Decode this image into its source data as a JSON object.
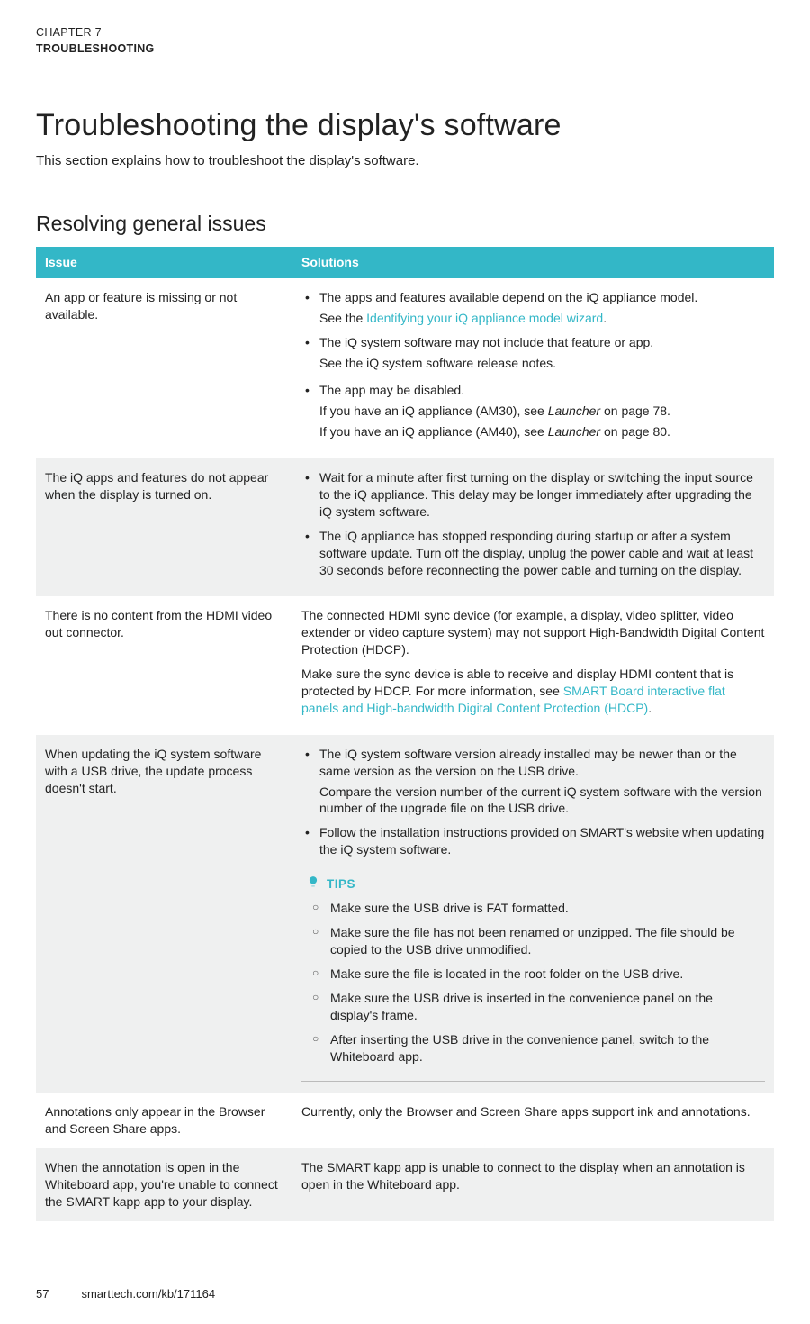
{
  "chapter": {
    "line": "CHAPTER 7",
    "title": "TROUBLESHOOTING"
  },
  "page_title": "Troubleshooting the display's software",
  "intro": "This section explains how to troubleshoot the display's software.",
  "section_title": "Resolving general issues",
  "table_headers": {
    "issue": "Issue",
    "solutions": "Solutions"
  },
  "rows": {
    "r1": {
      "issue": "An app or feature is missing or not available.",
      "b1a": "The apps and features available depend on the iQ appliance model.",
      "b1b_pre": "See the ",
      "b1b_link": "Identifying your iQ appliance model wizard",
      "b1b_post": ".",
      "b2a": "The iQ system software may not include that feature or app.",
      "b2b": "See the iQ system software release notes.",
      "b3a": "The app may be disabled.",
      "b3b_pre": "If you have an iQ appliance (AM30), see ",
      "b3b_it": "Launcher",
      "b3b_post": " on page 78.",
      "b3c_pre": "If you have an iQ appliance (AM40), see ",
      "b3c_it": "Launcher",
      "b3c_post": " on page 80."
    },
    "r2": {
      "issue": "The iQ apps and features do not appear when the display is turned on.",
      "b1": "Wait for a minute after first turning on the display or switching the input source to the iQ appliance. This delay may be longer immediately after upgrading the iQ system software.",
      "b2": "The iQ appliance has stopped responding during startup or after a system software update. Turn off the display, unplug the power cable and wait at least 30 seconds before reconnecting the power cable and turning on the display."
    },
    "r3": {
      "issue": "There is no content from the HDMI video out connector.",
      "p1": "The connected HDMI sync device (for example, a display, video splitter, video extender or video capture system) may not support High-Bandwidth Digital Content Protection (HDCP).",
      "p2_pre": "Make sure the sync device is able to receive and display HDMI content that is protected by HDCP. For more information, see ",
      "p2_link": "SMART Board interactive flat panels and High-bandwidth Digital Content Protection (HDCP)",
      "p2_post": "."
    },
    "r4": {
      "issue": "When updating the iQ system software with a USB drive, the update process doesn't start.",
      "b1a": "The iQ system software version already installed may be newer than or the same version as the version on the USB drive.",
      "b1b": "Compare the version number of the current iQ system software with the version number of the upgrade file on the USB drive.",
      "b2": "Follow the installation instructions provided on SMART's website when updating the iQ system software.",
      "tips_label": "TIPS",
      "t1": "Make sure the USB drive is FAT formatted.",
      "t2": "Make sure the file has not been renamed or unzipped. The file should be copied to the USB drive unmodified.",
      "t3": "Make sure the file is located in the root folder on the USB drive.",
      "t4": "Make sure the USB drive is inserted in the convenience panel on the display's frame.",
      "t5": "After inserting the USB drive in the convenience panel, switch to the Whiteboard app."
    },
    "r5": {
      "issue": "Annotations only appear in the Browser and Screen Share apps.",
      "p1": "Currently, only the Browser and Screen Share apps support ink and annotations."
    },
    "r6": {
      "issue": "When the annotation is open in the Whiteboard app, you're unable to connect the SMART kapp app to your display.",
      "p1": "The SMART kapp app is unable to connect to the display when an annotation is open in the Whiteboard app."
    }
  },
  "footer": {
    "page": "57",
    "url": "smarttech.com/kb/171164"
  }
}
